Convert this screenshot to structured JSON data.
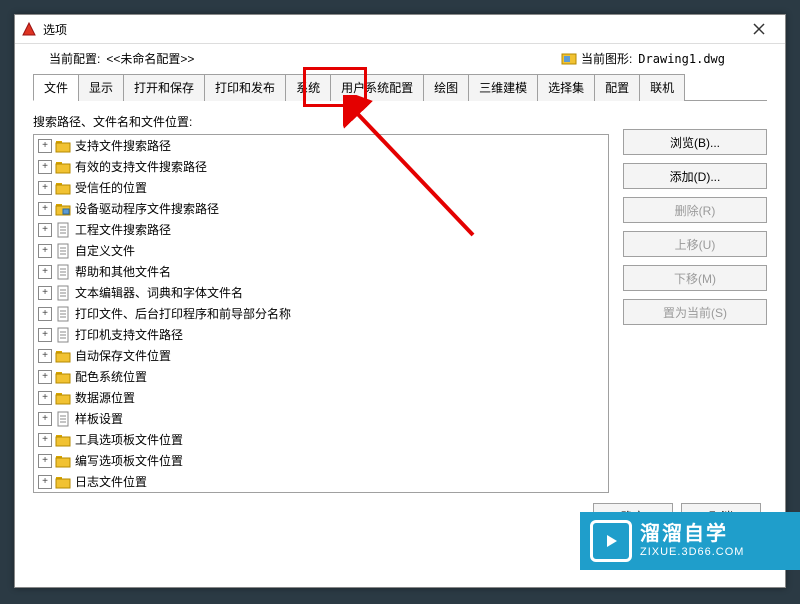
{
  "window": {
    "title": "选项"
  },
  "info": {
    "config_label": "当前配置:",
    "config_value": "<<未命名配置>>",
    "drawing_label": "当前图形:",
    "drawing_value": "Drawing1.dwg"
  },
  "tabs": [
    {
      "id": "files",
      "label": "文件",
      "active": true
    },
    {
      "id": "display",
      "label": "显示"
    },
    {
      "id": "opensave",
      "label": "打开和保存"
    },
    {
      "id": "print",
      "label": "打印和发布"
    },
    {
      "id": "system",
      "label": "系统"
    },
    {
      "id": "userpref",
      "label": "用户系统配置"
    },
    {
      "id": "draw",
      "label": "绘图"
    },
    {
      "id": "3dmodel",
      "label": "三维建模"
    },
    {
      "id": "selection",
      "label": "选择集"
    },
    {
      "id": "profile",
      "label": "配置"
    },
    {
      "id": "online",
      "label": "联机"
    }
  ],
  "list_label": "搜索路径、文件名和文件位置:",
  "tree": [
    {
      "icon": "folder",
      "label": "支持文件搜索路径"
    },
    {
      "icon": "folder",
      "label": "有效的支持文件搜索路径"
    },
    {
      "icon": "folder",
      "label": "受信任的位置"
    },
    {
      "icon": "folder-badge",
      "label": "设备驱动程序文件搜索路径"
    },
    {
      "icon": "doc",
      "label": "工程文件搜索路径"
    },
    {
      "icon": "doc",
      "label": "自定义文件"
    },
    {
      "icon": "doc",
      "label": "帮助和其他文件名"
    },
    {
      "icon": "doc",
      "label": "文本编辑器、词典和字体文件名"
    },
    {
      "icon": "doc",
      "label": "打印文件、后台打印程序和前导部分名称"
    },
    {
      "icon": "doc",
      "label": "打印机支持文件路径"
    },
    {
      "icon": "folder",
      "label": "自动保存文件位置"
    },
    {
      "icon": "folder",
      "label": "配色系统位置"
    },
    {
      "icon": "folder",
      "label": "数据源位置"
    },
    {
      "icon": "doc",
      "label": "样板设置"
    },
    {
      "icon": "folder",
      "label": "工具选项板文件位置"
    },
    {
      "icon": "folder",
      "label": "编写选项板文件位置"
    },
    {
      "icon": "folder",
      "label": "日志文件位置"
    }
  ],
  "buttons": {
    "browse": "浏览(B)...",
    "add": "添加(D)...",
    "remove": "删除(R)",
    "moveup": "上移(U)",
    "movedown": "下移(M)",
    "setcurrent": "置为当前(S)",
    "ok": "确定",
    "cancel": "取消"
  },
  "watermark": {
    "big": "溜溜自学",
    "small": "ZIXUE.3D66.COM"
  }
}
